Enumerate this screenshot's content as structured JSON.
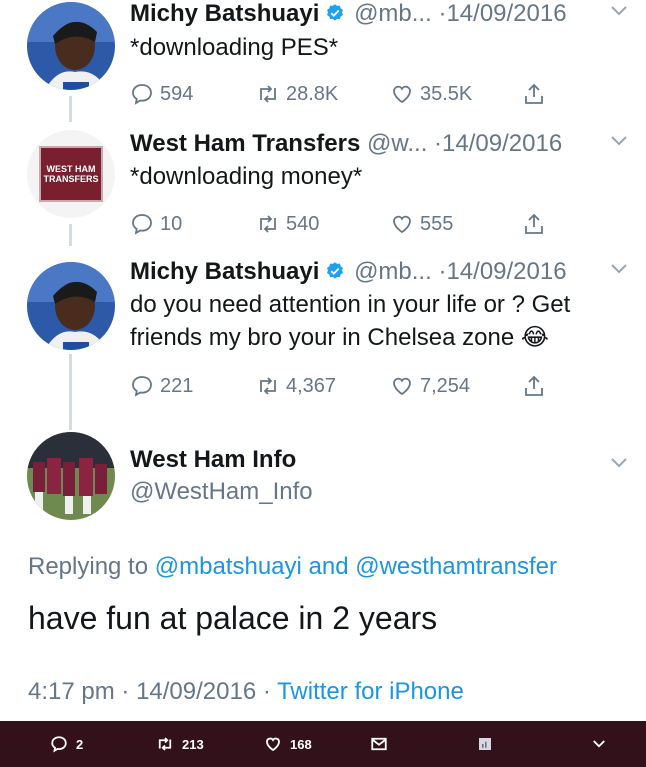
{
  "tweets": [
    {
      "name": "Michy Batshuayi",
      "handle": "@mb...",
      "dot": "·",
      "date": "14/09/2016",
      "text": "*downloading PES*",
      "replies": "594",
      "retweets": "28.8K",
      "likes": "35.5K",
      "verified": true
    },
    {
      "name": "West Ham Transfers",
      "handle": "@w...",
      "dot": "·",
      "date": "14/09/2016",
      "text": "*downloading money*",
      "replies": "10",
      "retweets": "540",
      "likes": "555",
      "logo_text_1": "WEST HAM",
      "logo_text_2": "TRANSFERS"
    },
    {
      "name": "Michy Batshuayi",
      "handle": "@mb...",
      "dot": "·",
      "date": "14/09/2016",
      "text_line1": "do you need attention in your life or ? Get",
      "text_line2": "friends my bro your in Chelsea zone 😂",
      "replies": "221",
      "retweets": "4,367",
      "likes": "7,254",
      "verified": true
    }
  ],
  "main_tweet": {
    "name": "West Ham Info",
    "handle": "@WestHam_Info",
    "replying_prefix": "Replying to",
    "mention1": "@mbatshuayi",
    "and": "and",
    "mention2": "@westhamtransfer",
    "text": "have fun at palace in 2 years",
    "time": "4:17 pm",
    "date": "14/09/2016",
    "source": "Twitter for iPhone",
    "sep": "·"
  },
  "bottom_bar": {
    "replies": "2",
    "retweets": "213",
    "likes": "168"
  },
  "colors": {
    "link": "#1b95e0",
    "muted": "#657786",
    "bar": "#33111b",
    "verified": "#1da1f2"
  }
}
